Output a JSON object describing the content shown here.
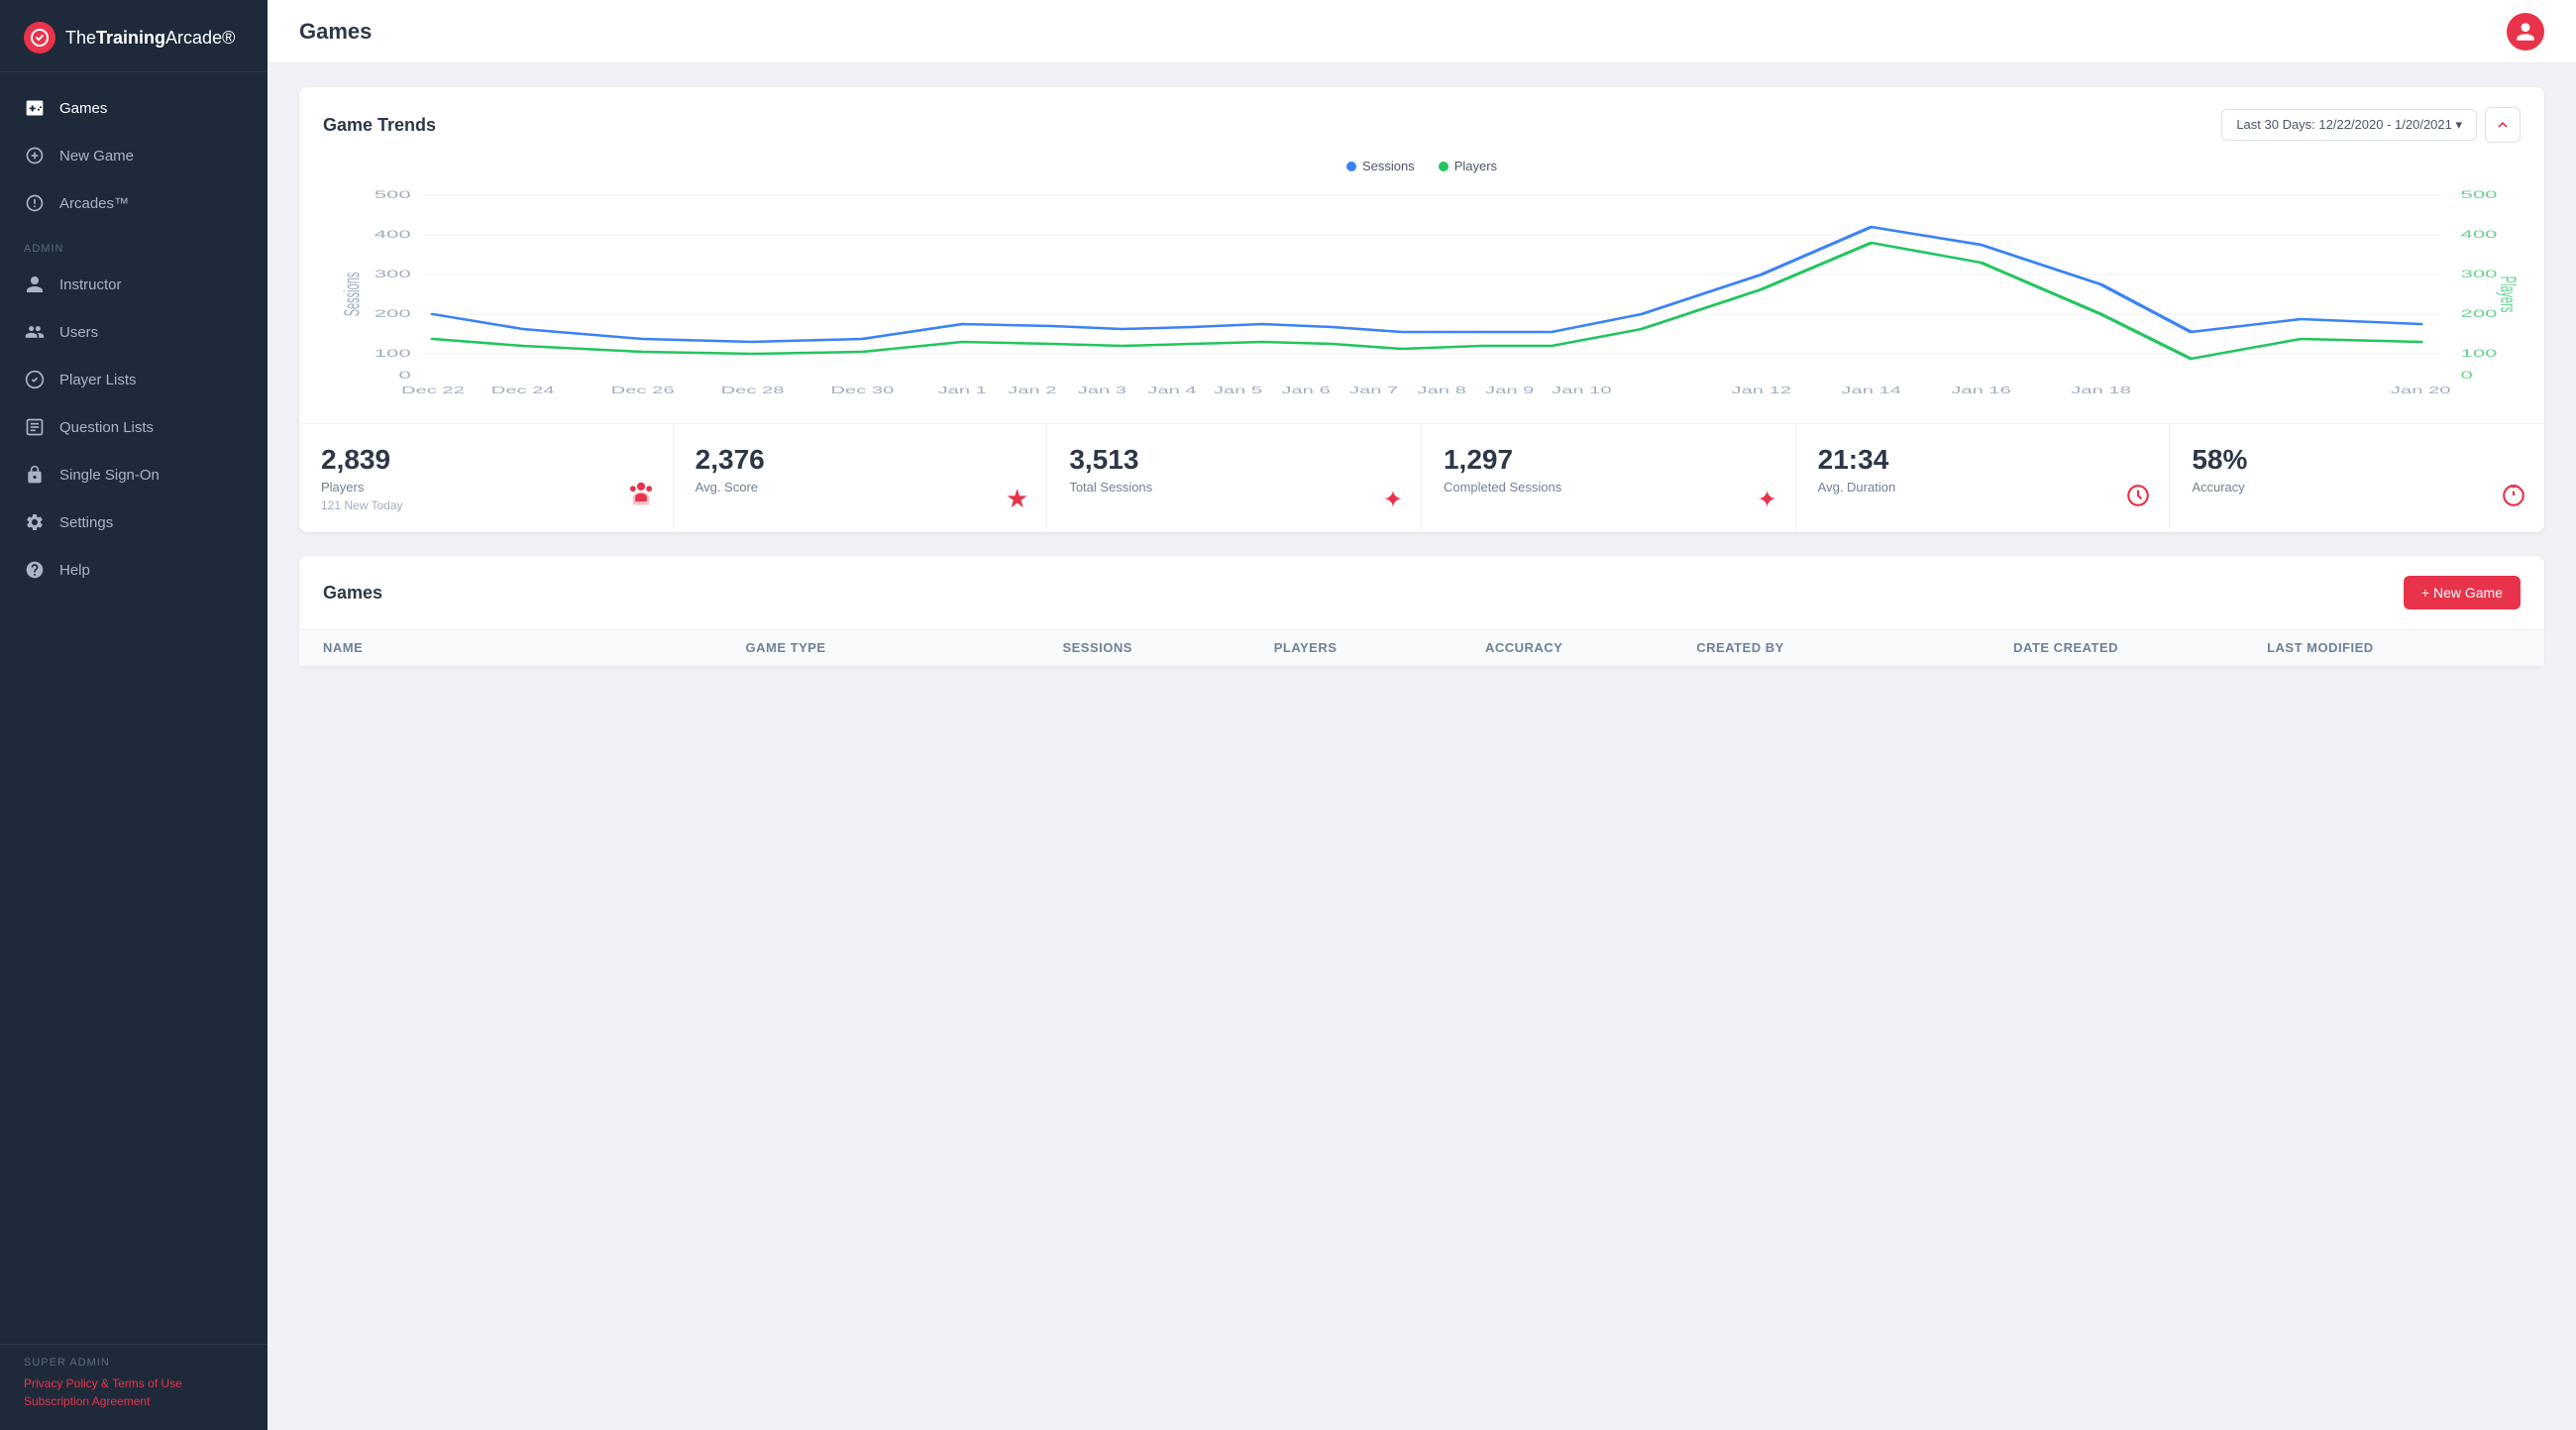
{
  "app": {
    "name_prefix": "The",
    "name_bold": "Training",
    "name_suffix": "Arcade",
    "logo_symbol": "★"
  },
  "page_title": "Games",
  "sidebar": {
    "nav_items": [
      {
        "id": "games",
        "label": "Games",
        "active": true
      },
      {
        "id": "new-game",
        "label": "New Game",
        "active": false
      },
      {
        "id": "arcades",
        "label": "Arcades™",
        "active": false
      }
    ],
    "admin_label": "ADMIN",
    "admin_items": [
      {
        "id": "instructor",
        "label": "Instructor"
      },
      {
        "id": "users",
        "label": "Users"
      },
      {
        "id": "player-lists",
        "label": "Player Lists"
      },
      {
        "id": "question-lists",
        "label": "Question Lists"
      },
      {
        "id": "single-sign-on",
        "label": "Single Sign-On"
      },
      {
        "id": "settings",
        "label": "Settings"
      },
      {
        "id": "help",
        "label": "Help"
      }
    ],
    "super_admin_label": "SUPER ADMIN",
    "footer_links": [
      {
        "label": "Privacy Policy & Terms of Use",
        "href": "#"
      },
      {
        "label": "Subscription Agreement",
        "href": "#"
      }
    ]
  },
  "game_trends": {
    "title": "Game Trends",
    "date_range": "Last 30 Days: 12/22/2020 - 1/20/2021",
    "legend": {
      "sessions_label": "Sessions",
      "players_label": "Players"
    },
    "sessions_color": "#3b82f6",
    "players_color": "#22c55e",
    "y_axis_left": [
      "500",
      "400",
      "300",
      "200",
      "100",
      "0"
    ],
    "y_axis_right": [
      "500",
      "400",
      "300",
      "200",
      "100",
      "0"
    ],
    "x_labels": [
      "Dec 22",
      "Dec 24",
      "Dec 26",
      "Dec 28",
      "Dec 30",
      "Jan 1",
      "Jan 2",
      "Jan 3",
      "Jan 4",
      "Jan 5",
      "Jan 6",
      "Jan 7",
      "Jan 8",
      "Jan 9",
      "Jan 10",
      "Jan 12",
      "Jan 14",
      "Jan 16",
      "Jan 18",
      "Jan 20"
    ],
    "y_left_label": "Sessions",
    "y_right_label": "Players"
  },
  "stats": [
    {
      "value": "2,839",
      "label": "Players",
      "sub": "121 New Today",
      "icon": "👤"
    },
    {
      "value": "2,376",
      "label": "Avg. Score",
      "sub": "",
      "icon": "★"
    },
    {
      "value": "3,513",
      "label": "Total Sessions",
      "sub": "",
      "icon": "✦"
    },
    {
      "value": "1,297",
      "label": "Completed Sessions",
      "sub": "",
      "icon": "✦"
    },
    {
      "value": "21:34",
      "label": "Avg. Duration",
      "sub": "",
      "icon": "⏱"
    },
    {
      "value": "58%",
      "label": "Accuracy",
      "sub": "",
      "icon": "⏻"
    }
  ],
  "games_table": {
    "title": "Games",
    "new_game_label": "+ New Game",
    "columns": [
      "Name",
      "Game Type",
      "Sessions",
      "Players",
      "Accuracy",
      "Created By",
      "Date Created",
      "Last Modified"
    ]
  }
}
